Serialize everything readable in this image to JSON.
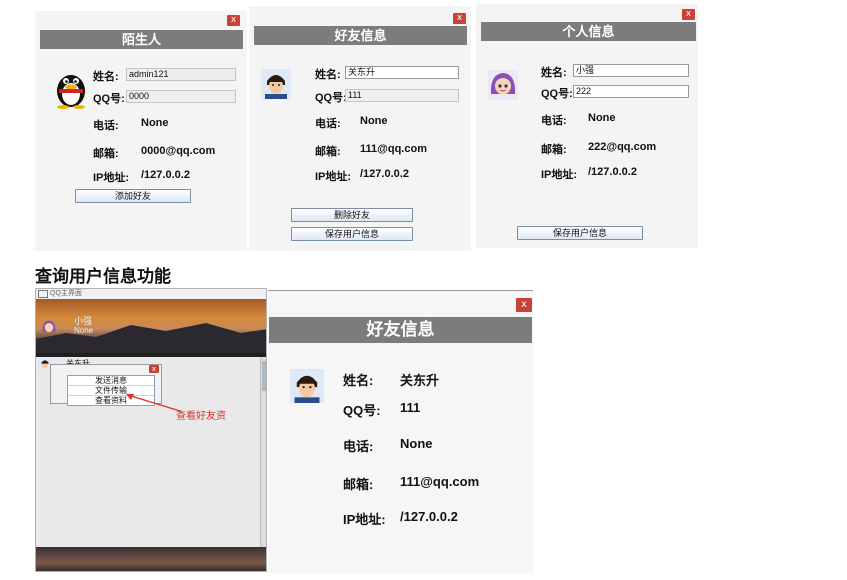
{
  "stranger": {
    "title": "陌生人",
    "name_label": "姓名:",
    "name_value": "admin121",
    "qq_label": "QQ号:",
    "qq_value": "0000",
    "phone_label": "电话:",
    "phone_value": "None",
    "email_label": "邮箱:",
    "email_value": "0000@qq.com",
    "ip_label": "IP地址:",
    "ip_value": "/127.0.0.2",
    "add_button": "添加好友",
    "close_label": "x"
  },
  "friend": {
    "title": "好友信息",
    "name_label": "姓名:",
    "name_value": "关东升",
    "qq_label": "QQ号:",
    "qq_value": "111",
    "phone_label": "电话:",
    "phone_value": "None",
    "email_label": "邮箱:",
    "email_value": "111@qq.com",
    "ip_label": "IP地址:",
    "ip_value": "/127.0.0.2",
    "delete_button": "删除好友",
    "save_button": "保存用户信息",
    "close_label": "x"
  },
  "personal": {
    "title": "个人信息",
    "name_label": "姓名:",
    "name_value": "小强",
    "qq_label": "QQ号:",
    "qq_value": "222",
    "phone_label": "电话:",
    "phone_value": "None",
    "email_label": "邮箱:",
    "email_value": "222@qq.com",
    "ip_label": "IP地址:",
    "ip_value": "/127.0.0.2",
    "save_button": "保存用户信息",
    "close_label": "x"
  },
  "section_heading": "查询用户信息功能",
  "main_window": {
    "title": "QQ主界面",
    "username": "小强",
    "status": "None",
    "friend_name": "关东升",
    "menu": [
      "发送消息",
      "文件传输",
      "查看资料"
    ],
    "annotation": "查看好友资",
    "close_label": "x"
  },
  "friend_large": {
    "title": "好友信息",
    "name_label": "姓名:",
    "name_value": "关东升",
    "qq_label": "QQ号:",
    "qq_value": "111",
    "phone_label": "电话:",
    "phone_value": "None",
    "email_label": "邮箱:",
    "email_value": "111@qq.com",
    "ip_label": "IP地址:",
    "ip_value": "/127.0.0.2",
    "close_label": "x"
  },
  "colors": {
    "title_bar": "#7c7c7c",
    "close_button": "#c8423a",
    "annotation": "#e03030"
  }
}
